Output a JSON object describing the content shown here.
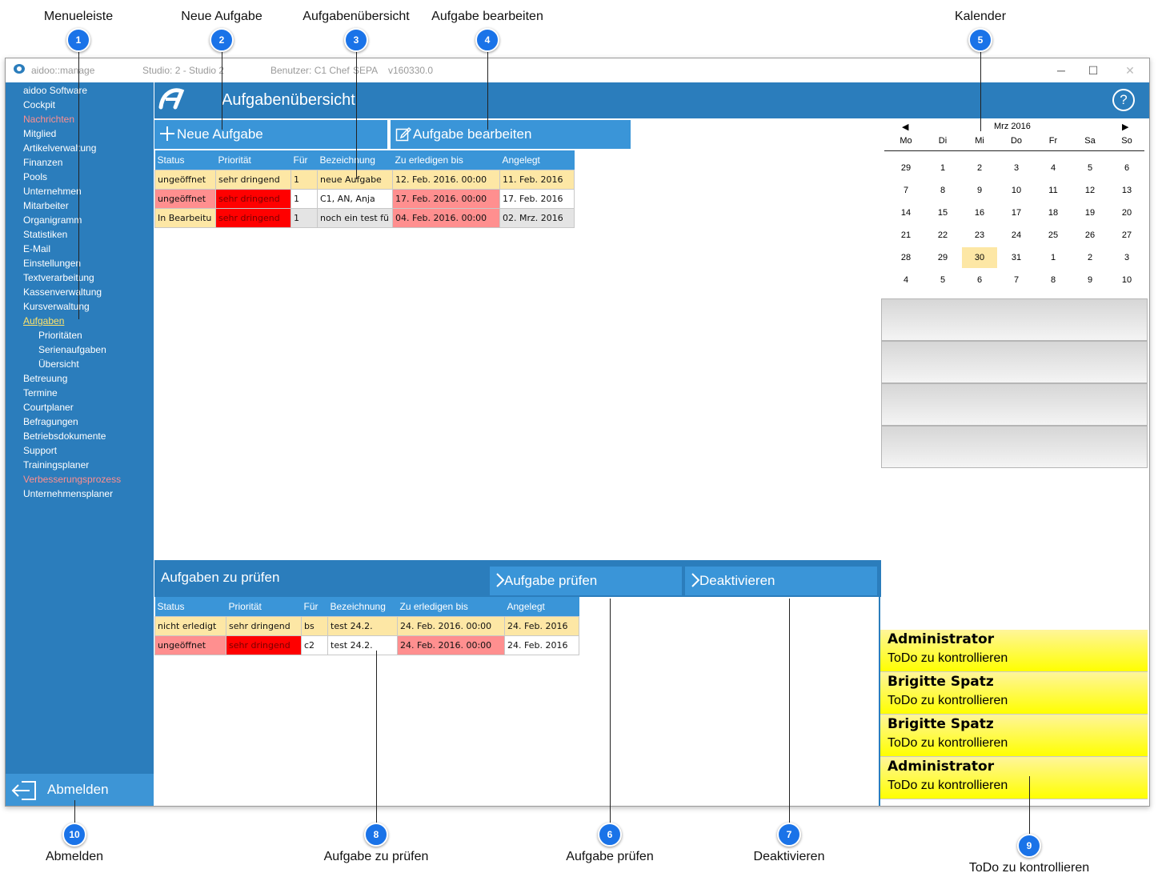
{
  "callouts": [
    {
      "num": "1",
      "label": "Menueleiste"
    },
    {
      "num": "2",
      "label": "Neue Aufgabe"
    },
    {
      "num": "3",
      "label": "Aufgabenübersicht"
    },
    {
      "num": "4",
      "label": "Aufgabe bearbeiten"
    },
    {
      "num": "5",
      "label": "Kalender"
    },
    {
      "num": "6",
      "label": "Aufgabe prüfen"
    },
    {
      "num": "7",
      "label": "Deaktivieren"
    },
    {
      "num": "8",
      "label": "Aufgabe zu prüfen"
    },
    {
      "num": "9",
      "label": "ToDo zu kontrollieren"
    },
    {
      "num": "10",
      "label": "Abmelden"
    }
  ],
  "titlebar": {
    "app": "aidoo::manage",
    "studio": "Studio: 2 - Studio 2",
    "user": "Benutzer: C1 Chef",
    "sepa": "SEPA",
    "version": "v160330.0",
    "minimize": "─",
    "maximize": "☐",
    "close": "✕"
  },
  "sidebar": {
    "items": [
      {
        "label": "aidoo Software"
      },
      {
        "label": "Cockpit"
      },
      {
        "label": "Nachrichten"
      },
      {
        "label": "Mitglied"
      },
      {
        "label": "Artikelverwaltung"
      },
      {
        "label": "Finanzen"
      },
      {
        "label": "Pools"
      },
      {
        "label": "Unternehmen"
      },
      {
        "label": "Mitarbeiter"
      },
      {
        "label": "Organigramm"
      },
      {
        "label": "Statistiken"
      },
      {
        "label": "E-Mail"
      },
      {
        "label": "Einstellungen"
      },
      {
        "label": "Textverarbeitung"
      },
      {
        "label": "Kassenverwaltung"
      },
      {
        "label": "Kursverwaltung"
      },
      {
        "label": "Aufgaben"
      },
      {
        "label": "Prioritäten"
      },
      {
        "label": "Serienaufgaben"
      },
      {
        "label": "Übersicht"
      },
      {
        "label": "Betreuung"
      },
      {
        "label": "Termine"
      },
      {
        "label": "Courtplaner"
      },
      {
        "label": "Befragungen"
      },
      {
        "label": "Betriebsdokumente"
      },
      {
        "label": "Support"
      },
      {
        "label": "Trainingsplaner"
      },
      {
        "label": "Verbesserungsprozess"
      },
      {
        "label": "Unternehmensplaner"
      }
    ],
    "logout_label": "Abmelden"
  },
  "header": {
    "title": "Aufgabenübersicht",
    "help": "?"
  },
  "toolbar": {
    "new_label": "Neue Aufgabe",
    "edit_label": "Aufgabe bearbeiten"
  },
  "tasks": {
    "columns": [
      "Status",
      "Priorität",
      "Für",
      "Bezeichnung",
      "Zu erledigen bis",
      "Angelegt"
    ],
    "rows": [
      [
        "ungeöffnet",
        "sehr dringend",
        "1",
        "neue Aufgabe",
        "12. Feb. 2016. 00:00",
        "11. Feb. 2016"
      ],
      [
        "ungeöffnet",
        "sehr dringend",
        "1",
        "C1, AN, Anja",
        "17. Feb. 2016. 00:00",
        "17. Feb. 2016"
      ],
      [
        "In Bearbeitu",
        "sehr dringend",
        "1",
        "noch ein test fü",
        "04. Feb. 2016. 00:00",
        "02. Mrz. 2016"
      ]
    ]
  },
  "review": {
    "title": "Aufgaben zu prüfen",
    "check_label": "Aufgabe prüfen",
    "deactivate_label": "Deaktivieren",
    "columns": [
      "Status",
      "Priorität",
      "Für",
      "Bezeichnung",
      "Zu erledigen bis",
      "Angelegt"
    ],
    "rows": [
      [
        "nicht erledigt",
        "sehr dringend",
        "bs",
        "test 24.2.",
        "24. Feb. 2016. 00:00",
        "24. Feb. 2016"
      ],
      [
        "ungeöffnet",
        "sehr dringend",
        "c2",
        "test 24.2.",
        "24. Feb. 2016. 00:00",
        "24. Feb. 2016"
      ]
    ]
  },
  "calendar": {
    "month": "Mrz 2016",
    "prev": "◀",
    "next": "▶",
    "weekdays": [
      "Mo",
      "Di",
      "Mi",
      "Do",
      "Fr",
      "Sa",
      "So"
    ],
    "weeks": [
      [
        "29",
        "1",
        "2",
        "3",
        "4",
        "5",
        "6"
      ],
      [
        "7",
        "8",
        "9",
        "10",
        "11",
        "12",
        "13"
      ],
      [
        "14",
        "15",
        "16",
        "17",
        "18",
        "19",
        "20"
      ],
      [
        "21",
        "22",
        "23",
        "24",
        "25",
        "26",
        "27"
      ],
      [
        "28",
        "29",
        "30",
        "31",
        "1",
        "2",
        "3"
      ],
      [
        "4",
        "5",
        "6",
        "7",
        "8",
        "9",
        "10"
      ]
    ],
    "today": "30"
  },
  "todos": [
    {
      "who": "Administrator",
      "what": "ToDo zu kontrollieren"
    },
    {
      "who": "Brigitte Spatz",
      "what": "ToDo zu kontrollieren"
    },
    {
      "who": "Brigitte Spatz",
      "what": "ToDo zu kontrollieren"
    },
    {
      "who": "Administrator",
      "what": "ToDo zu kontrollieren"
    }
  ],
  "colors": {
    "brand_blue": "#2b7dbc",
    "button_blue": "#3a95d8",
    "todo_yellow": "#ffff00",
    "urgent_red": "#ff0000",
    "row_yellow": "#fde7a5",
    "row_pink": "#ff8f8f",
    "menu_red": "#ff8f8f",
    "menu_active": "#ffe46b",
    "badge_blue": "#1a73e8"
  }
}
